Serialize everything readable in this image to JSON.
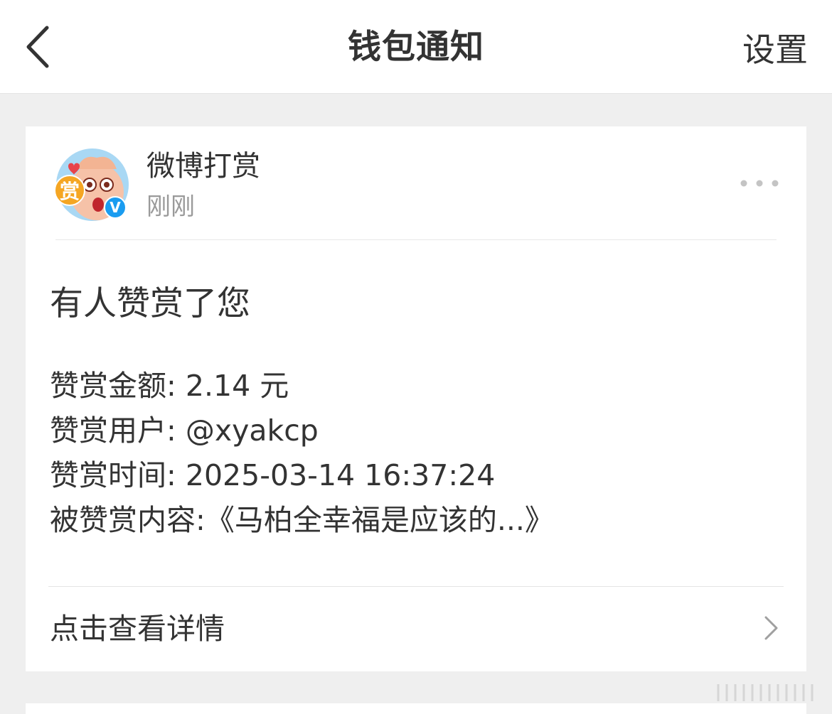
{
  "nav": {
    "back_icon": "chevron-left-icon",
    "title": "钱包通知",
    "settings_label": "设置"
  },
  "message": {
    "sender": "微博打赏",
    "time": "刚刚",
    "avatar_badge": "赏",
    "verified_badge": "V",
    "more_icon": "more-dots-icon",
    "headline": "有人赞赏了您",
    "details": [
      {
        "label": "赞赏金额:",
        "value": "2.14 元"
      },
      {
        "label": "赞赏用户:",
        "value": "@xyakcp"
      },
      {
        "label": "赞赏时间:",
        "value": "2025-03-14 16:37:24"
      },
      {
        "label": "被赞赏内容:",
        "value": "《马柏全幸福是应该的...》"
      }
    ],
    "detail_link_label": "点击查看详情",
    "detail_link_icon": "chevron-right-icon"
  },
  "colors": {
    "background": "#efefef",
    "card": "#ffffff",
    "text_primary": "#333333",
    "text_secondary": "#9a9a9a",
    "avatar_bg": "#9fd3f2",
    "badge_orange": "#f5a623",
    "verified_blue": "#1a9cf0"
  }
}
